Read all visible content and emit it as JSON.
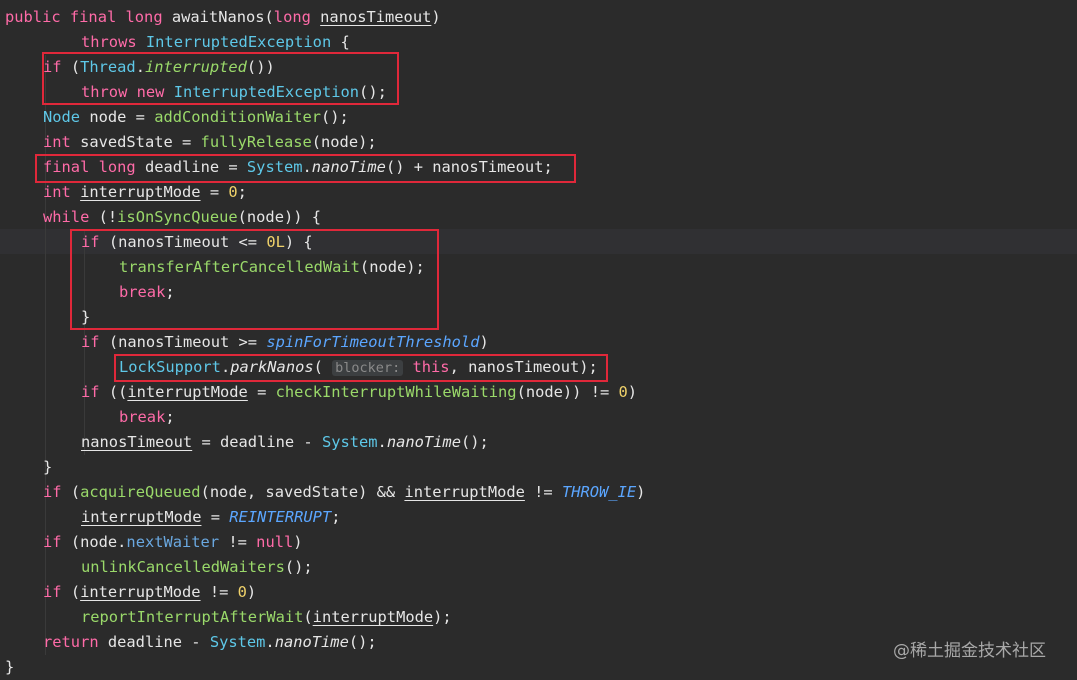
{
  "code": {
    "l1": {
      "t0": "public",
      "t1": " ",
      "t2": "final",
      "t3": " ",
      "t4": "long",
      "t5": " awaitNanos(",
      "t6": "long",
      "t7": " ",
      "t8": "nanosTimeout",
      "t9": ")"
    },
    "l2": {
      "t0": "throws",
      "t1": " ",
      "t2": "InterruptedException",
      "t3": " {"
    },
    "l3": {
      "t0": "if",
      "t1": " (",
      "t2": "Thread",
      "t3": ".",
      "t4": "interrupted",
      "t5": "())"
    },
    "l4": {
      "t0": "throw",
      "t1": " ",
      "t2": "new",
      "t3": " ",
      "t4": "InterruptedException",
      "t5": "();"
    },
    "l5": {
      "t0": "Node",
      "t1": " node = ",
      "t2": "addConditionWaiter",
      "t3": "();"
    },
    "l6": {
      "t0": "int",
      "t1": " savedState = ",
      "t2": "fullyRelease",
      "t3": "(node);"
    },
    "l7": {
      "t0": "final",
      "t1": " ",
      "t2": "long",
      "t3": " deadline = ",
      "t4": "System",
      "t5": ".",
      "t6": "nanoTime",
      "t7": "() + nanosTimeout;"
    },
    "l8": {
      "t0": "int",
      "t1": " ",
      "t2": "interruptMode",
      "t3": " = ",
      "t4": "0",
      "t5": ";"
    },
    "l9": {
      "t0": "while",
      "t1": " (!",
      "t2": "isOnSyncQueue",
      "t3": "(node)) {"
    },
    "l10": {
      "t0": "if",
      "t1": " (nanosTimeout <= ",
      "t2": "0L",
      "t3": ") {"
    },
    "l11": {
      "t0": "transferAfterCancelledWait",
      "t1": "(node);"
    },
    "l12": {
      "t0": "break",
      "t1": ";"
    },
    "l13": {
      "t0": "}"
    },
    "l14": {
      "t0": "if",
      "t1": " (nanosTimeout >= ",
      "t2": "spinForTimeoutThreshold",
      "t3": ")"
    },
    "l15": {
      "t0": "LockSupport",
      "t1": ".",
      "t2": "parkNanos",
      "t3": "( ",
      "hint": "blocker:",
      "t4": " ",
      "t5": "this",
      "t6": ", nanosTimeout);"
    },
    "l16": {
      "t0": "if",
      "t1": " ((",
      "t2": "interruptMode",
      "t3": " = ",
      "t4": "checkInterruptWhileWaiting",
      "t5": "(node)) != ",
      "t6": "0",
      "t7": ")"
    },
    "l17": {
      "t0": "break",
      "t1": ";"
    },
    "l18": {
      "t0": "nanosTimeout",
      "t1": " = deadline - ",
      "t2": "System",
      "t3": ".",
      "t4": "nanoTime",
      "t5": "();"
    },
    "l19": {
      "t0": "}"
    },
    "l20": {
      "t0": "if",
      "t1": " (",
      "t2": "acquireQueued",
      "t3": "(node, savedState) && ",
      "t4": "interruptMode",
      "t5": " != ",
      "t6": "THROW_IE",
      "t7": ")"
    },
    "l21": {
      "t0": "interruptMode",
      "t1": " = ",
      "t2": "REINTERRUPT",
      "t3": ";"
    },
    "l22": {
      "t0": "if",
      "t1": " (node.",
      "t2": "nextWaiter",
      "t3": " != ",
      "t4": "null",
      "t5": ")"
    },
    "l23": {
      "t0": "unlinkCancelledWaiters",
      "t1": "();"
    },
    "l24": {
      "t0": "if",
      "t1": " (",
      "t2": "interruptMode",
      "t3": " != ",
      "t4": "0",
      "t5": ")"
    },
    "l25": {
      "t0": "reportInterruptAfterWait",
      "t1": "(",
      "t2": "interruptMode",
      "t3": ");"
    },
    "l26": {
      "t0": "return",
      "t1": " deadline - ",
      "t2": "System",
      "t3": ".",
      "t4": "nanoTime",
      "t5": "();"
    },
    "l27": {
      "t0": "}"
    }
  },
  "watermark": "@稀土掘金技术社区",
  "colors": {
    "background": "#2b2b2b",
    "keyword": "#ff6ba8",
    "type": "#5ec8e8",
    "method": "#9ad96a",
    "field": "#6aa8e0",
    "constant": "#5ba6ff",
    "number": "#f0d26a",
    "highlight_box": "#e0283a"
  }
}
